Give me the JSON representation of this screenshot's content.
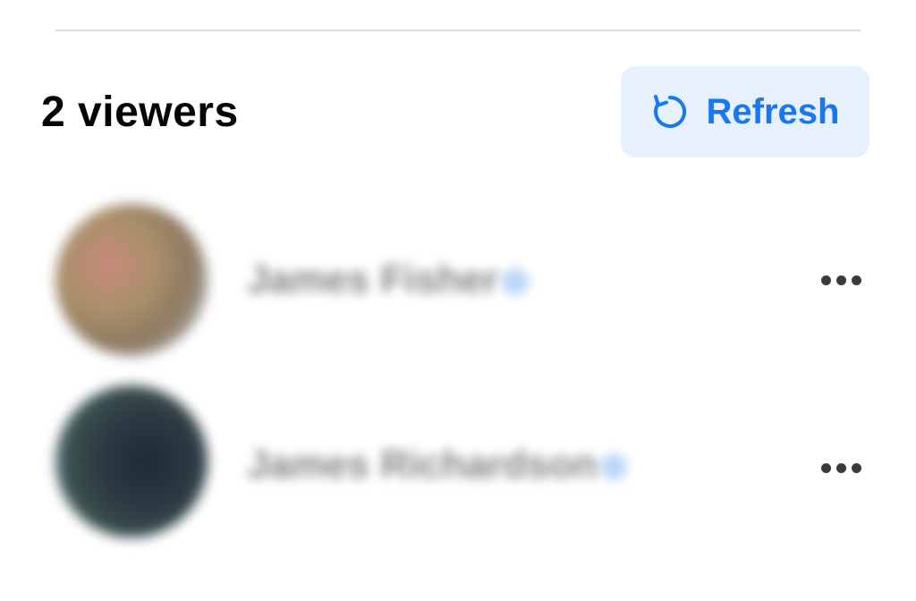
{
  "header": {
    "viewers_count": "2 viewers",
    "refresh_label": "Refresh",
    "refresh_icon": "refresh-icon"
  },
  "viewers": [
    {
      "name": "James Fisher",
      "verified": true,
      "more_icon": "more-options-icon"
    },
    {
      "name": "James Richardson",
      "verified": true,
      "more_icon": "more-options-icon"
    }
  ],
  "colors": {
    "accent": "#1877f2",
    "refresh_bg": "#e7f1fd",
    "text_primary": "#050505",
    "divider": "#dcdde0"
  }
}
